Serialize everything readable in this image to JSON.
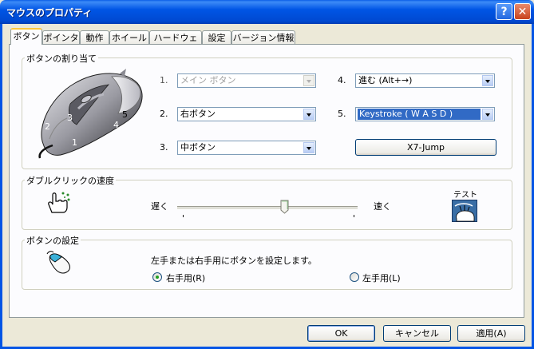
{
  "window": {
    "title": "マウスのプロパティ",
    "help_glyph": "?",
    "close_glyph": "✕"
  },
  "tabs": [
    {
      "label": "ボタン",
      "active": true
    },
    {
      "label": "ポインタ"
    },
    {
      "label": "動作"
    },
    {
      "label": "ホイール"
    },
    {
      "label": "ハードウェア"
    },
    {
      "label": "設定"
    },
    {
      "label": "バージョン情報"
    }
  ],
  "button_assign": {
    "legend": "ボタンの割り当て",
    "mouse_labels": {
      "b1": "1",
      "b2": "2",
      "b3": "3",
      "b4": "4",
      "b5": "5"
    },
    "rows": [
      {
        "number": "1.",
        "value": "メイン ボタン",
        "disabled": true
      },
      {
        "number": "2.",
        "value": "右ボタン"
      },
      {
        "number": "3.",
        "value": "中ボタン"
      },
      {
        "number": "4.",
        "value": "進む (Alt+→)"
      },
      {
        "number": "5.",
        "value": "Keystroke ( W A S D )",
        "selected": true
      }
    ],
    "x7_button": "X7-Jump"
  },
  "double_click": {
    "legend": "ダブルクリックの速度",
    "slow": "遅く",
    "fast": "速く",
    "test_label": "テスト",
    "speed_fraction": 0.6
  },
  "button_config": {
    "legend": "ボタンの設定",
    "description": "左手または右手用にボタンを設定します。",
    "right_hand": "右手用(R)",
    "left_hand": "左手用(L)",
    "selected": "right"
  },
  "footer": {
    "ok": "OK",
    "cancel": "キャンセル",
    "apply": "適用(A)"
  },
  "colors": {
    "title_blue": "#0055e5",
    "selection": "#316ac5",
    "tab_highlight": "#ffc83c"
  }
}
